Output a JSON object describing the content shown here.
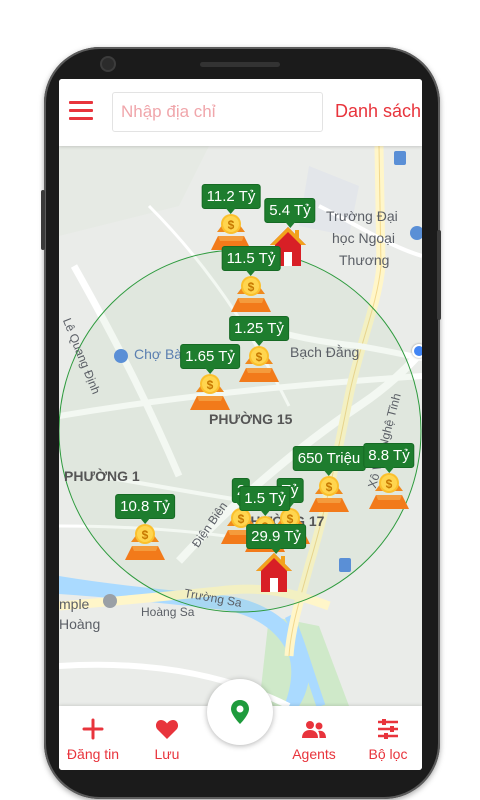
{
  "header": {
    "search_placeholder": "Nhập địa chỉ",
    "list_label": "Danh sách"
  },
  "map": {
    "place_labels": [
      "Trường Đại",
      "học Ngoại",
      "Thương",
      "Chợ Bà",
      "Bạch Đằng",
      "PHƯỜNG 15",
      "PHƯỜNG 1",
      "PHƯỜNG 17",
      "Lê Quang Định",
      "Điện Biên",
      "Xô Viết Nghệ Tĩnh",
      "Trường Sa",
      "Hoàng Sa",
      "mple",
      "Hoàng"
    ],
    "markers": [
      {
        "label": "11.2 Tỷ",
        "icon": "money-icon"
      },
      {
        "label": "5.4 Tỷ",
        "icon": "house-icon"
      },
      {
        "label": "11.5 Tỷ",
        "icon": "money-icon"
      },
      {
        "label": "1.25 Tỷ",
        "icon": "money-icon"
      },
      {
        "label": "1.65 Tỷ",
        "icon": "money-icon"
      },
      {
        "label": "650 Triệu",
        "icon": "money-icon"
      },
      {
        "label": "8.8 Tỷ",
        "icon": "money-icon"
      },
      {
        "label": "2",
        "icon": "money-icon"
      },
      {
        "label": "Tỷ",
        "icon": "money-icon"
      },
      {
        "label": "1.5 Tỷ",
        "icon": "money-icon"
      },
      {
        "label": "10.8 Tỷ",
        "icon": "money-icon"
      },
      {
        "label": "29.9 Tỷ",
        "icon": "house-icon"
      }
    ],
    "colors": {
      "price_tag": "#1e7d2e",
      "accent": "#e8343c",
      "radius": "#2e9b3e"
    }
  },
  "bottom_nav": {
    "post": "Đăng tin",
    "saved": "Lưu",
    "agents": "Agents",
    "filter": "Bộ lọc",
    "center_icon": "location-pin-icon"
  }
}
